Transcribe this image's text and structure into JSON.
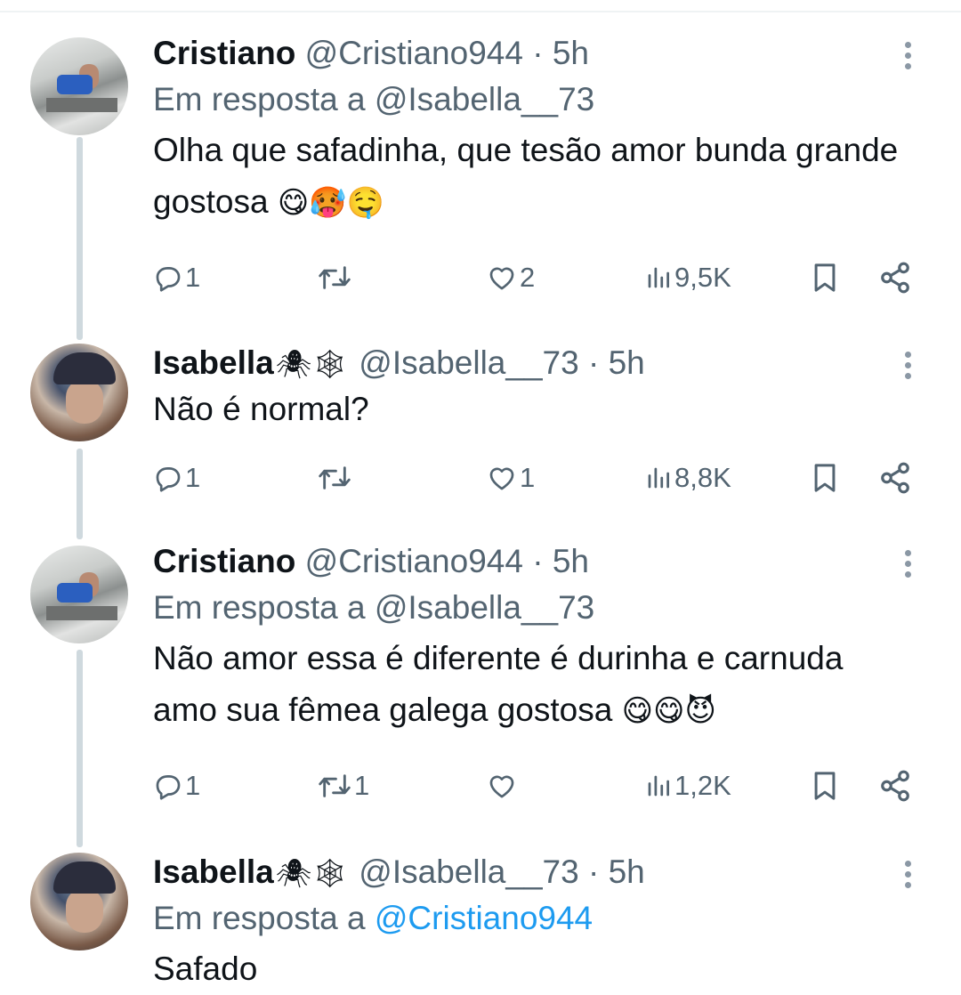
{
  "tweets": [
    {
      "name": "Cristiano",
      "handle": "@Cristiano944",
      "dot": "·",
      "time": "5h",
      "reply_prefix": "Em resposta a",
      "reply_to": "@Isabella__73",
      "reply_is_link": false,
      "text": "Olha que safadinha, que tesão amor bunda grande gostosa",
      "emojis": "😋🥵🤤",
      "counts": {
        "replies": "1",
        "retweets": "",
        "likes": "2",
        "views": "9,5K"
      }
    },
    {
      "name": "Isabella",
      "badges": "🕷🕸",
      "handle": "@Isabella__73",
      "dot": "·",
      "time": "5h",
      "text": "Não é normal?",
      "counts": {
        "replies": "1",
        "retweets": "",
        "likes": "1",
        "views": "8,8K"
      }
    },
    {
      "name": "Cristiano",
      "handle": "@Cristiano944",
      "dot": "·",
      "time": "5h",
      "reply_prefix": "Em resposta a",
      "reply_to": "@Isabella__73",
      "reply_is_link": false,
      "text_line1": "Não amor essa é diferente é durinha e carnuda",
      "text_line2": "amo sua fêmea galega gostosa",
      "emojis": "😋😋😈",
      "counts": {
        "replies": "1",
        "retweets": "1",
        "likes": "",
        "views": "1,2K"
      }
    },
    {
      "name": "Isabella",
      "badges": "🕷🕸",
      "handle": "@Isabella__73",
      "dot": "·",
      "time": "5h",
      "reply_prefix": "Em resposta a",
      "reply_to": "@Cristiano944",
      "reply_is_link": true,
      "text": "Safado"
    }
  ],
  "colors": {
    "text": "#0f1419",
    "secondary": "#536471",
    "link": "#1d9bf0",
    "thread_line": "#cfd9de"
  }
}
